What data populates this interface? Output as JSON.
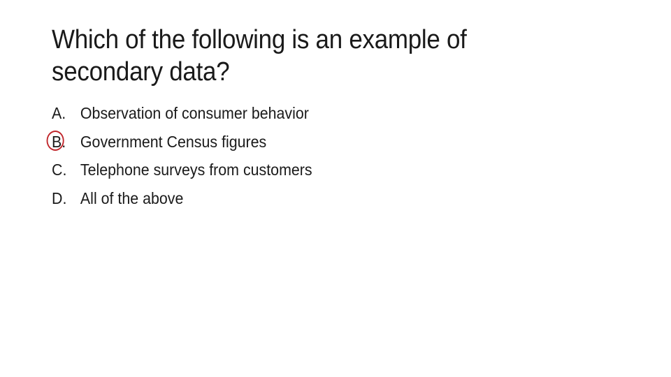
{
  "slide": {
    "title": "Which of the following is an example of secondary data?",
    "options": [
      {
        "letter": "A.",
        "text": "Observation of consumer behavior",
        "circled": false
      },
      {
        "letter": "B.",
        "text": "Government Census figures",
        "circled": true
      },
      {
        "letter": "C.",
        "text": "Telephone surveys from customers",
        "circled": false
      },
      {
        "letter": "D.",
        "text": "All of the above",
        "circled": false
      }
    ],
    "highlight_color": "#c0262b"
  }
}
